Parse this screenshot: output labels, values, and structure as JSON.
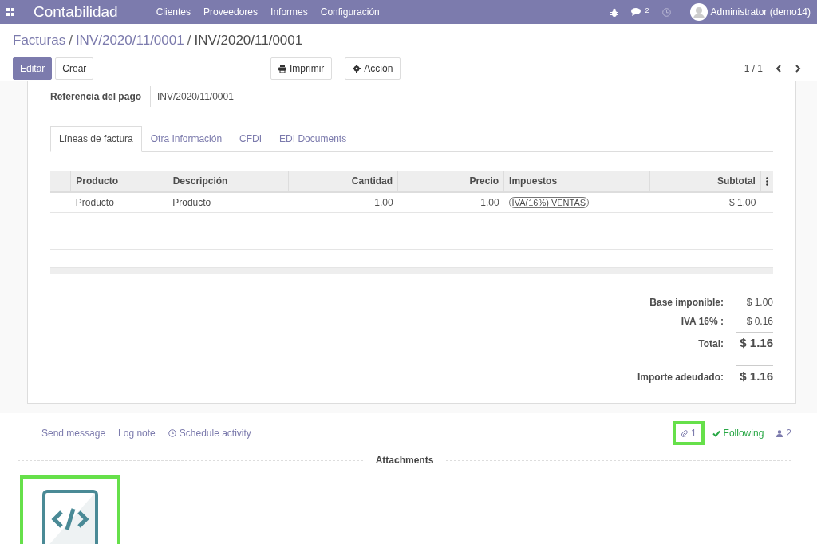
{
  "navbar": {
    "app_title": "Contabilidad",
    "menu": [
      "Clientes",
      "Proveedores",
      "Informes",
      "Configuración"
    ],
    "messages_count": "2",
    "user": "Administrator (demo14)"
  },
  "breadcrumb_separator": "/",
  "breadcrumbs": [
    {
      "label": "Facturas",
      "active": false
    },
    {
      "label": "INV/2020/11/0001",
      "active": false
    },
    {
      "label": "INV/2020/11/0001",
      "active": true
    }
  ],
  "main_buttons": [
    {
      "label": "Editar",
      "kind": "primary"
    },
    {
      "label": "Crear",
      "kind": "secondary"
    }
  ],
  "action_buttons": [
    {
      "label": "Imprimir",
      "kind": "print"
    },
    {
      "label": "Acción",
      "kind": "gear"
    }
  ],
  "pager": "1 / 1",
  "field": {
    "label": "Referencia del pago",
    "value": "INV/2020/11/0001"
  },
  "tabs": [
    {
      "label": "Líneas de factura",
      "selected": true
    },
    {
      "label": "Otra Información",
      "selected": false
    },
    {
      "label": "CFDI",
      "selected": false
    },
    {
      "label": "EDI Documents",
      "selected": false
    }
  ],
  "table": {
    "columns": [
      "Producto",
      "Descripción",
      "Cantidad",
      "Precio",
      "Impuestos",
      "Subtotal"
    ],
    "rows": [
      {
        "product": "Producto",
        "description": "Producto",
        "quantity": "1.00",
        "price": "1.00",
        "taxes": [
          "IVA(16%) VENTAS"
        ],
        "subtotal": "$ 1.00"
      }
    ]
  },
  "totals": [
    {
      "label": "Base imponible:",
      "value": "$ 1.00",
      "kind": "line"
    },
    {
      "label": "IVA 16% :",
      "value": "$ 0.16",
      "kind": "line"
    },
    {
      "label": "Total:",
      "value": "$ 1.16",
      "kind": "grand"
    },
    {
      "label": "Importe adeudado:",
      "value": "$ 1.16",
      "kind": "grand"
    }
  ],
  "chatter": {
    "actions": [
      {
        "label": "Send message",
        "kind": "text"
      },
      {
        "label": "Log note",
        "kind": "text"
      },
      {
        "label": "Schedule activity",
        "kind": "clock"
      }
    ],
    "attachment_count": {
      "label": "1",
      "highlighted": true
    },
    "follow": "Following",
    "followers": "2",
    "divider": "Attachments",
    "attachments": [
      {
        "kind": "code",
        "highlighted": true
      }
    ]
  }
}
